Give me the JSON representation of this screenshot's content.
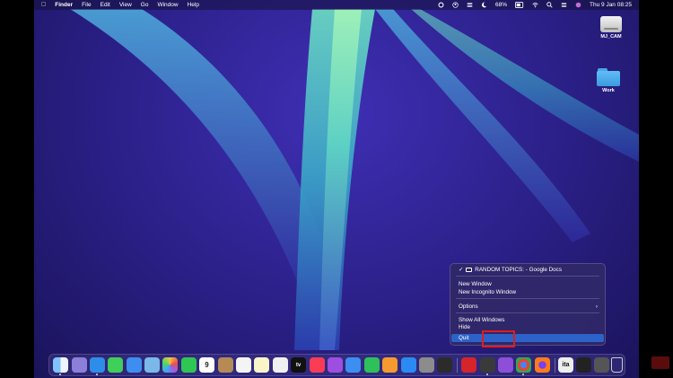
{
  "menubar": {
    "app_name": "Finder",
    "menus": [
      "File",
      "Edit",
      "View",
      "Go",
      "Window",
      "Help"
    ],
    "battery": "68%",
    "datetime": "Thu 9 Jan  08:25"
  },
  "desktop_icons": [
    {
      "label": "MJ_CAM",
      "icon": "drive-icon"
    },
    {
      "label": "Work",
      "icon": "folder-icon"
    }
  ],
  "context_menu": {
    "window_item": "RANDOM TOPICS: - Google Docs",
    "new_window": "New Window",
    "new_incognito": "New Incognito Window",
    "options": "Options",
    "options_arrow": "›",
    "show_all": "Show All Windows",
    "hide": "Hide",
    "quit": "Quit",
    "checkmark": "✓"
  },
  "dock": {
    "calendar_day": "9",
    "tv_label": "tv",
    "ita_label": "ita"
  },
  "colors": {
    "highlight": "#2d62c9",
    "annotation_box": "#e21b1b"
  }
}
